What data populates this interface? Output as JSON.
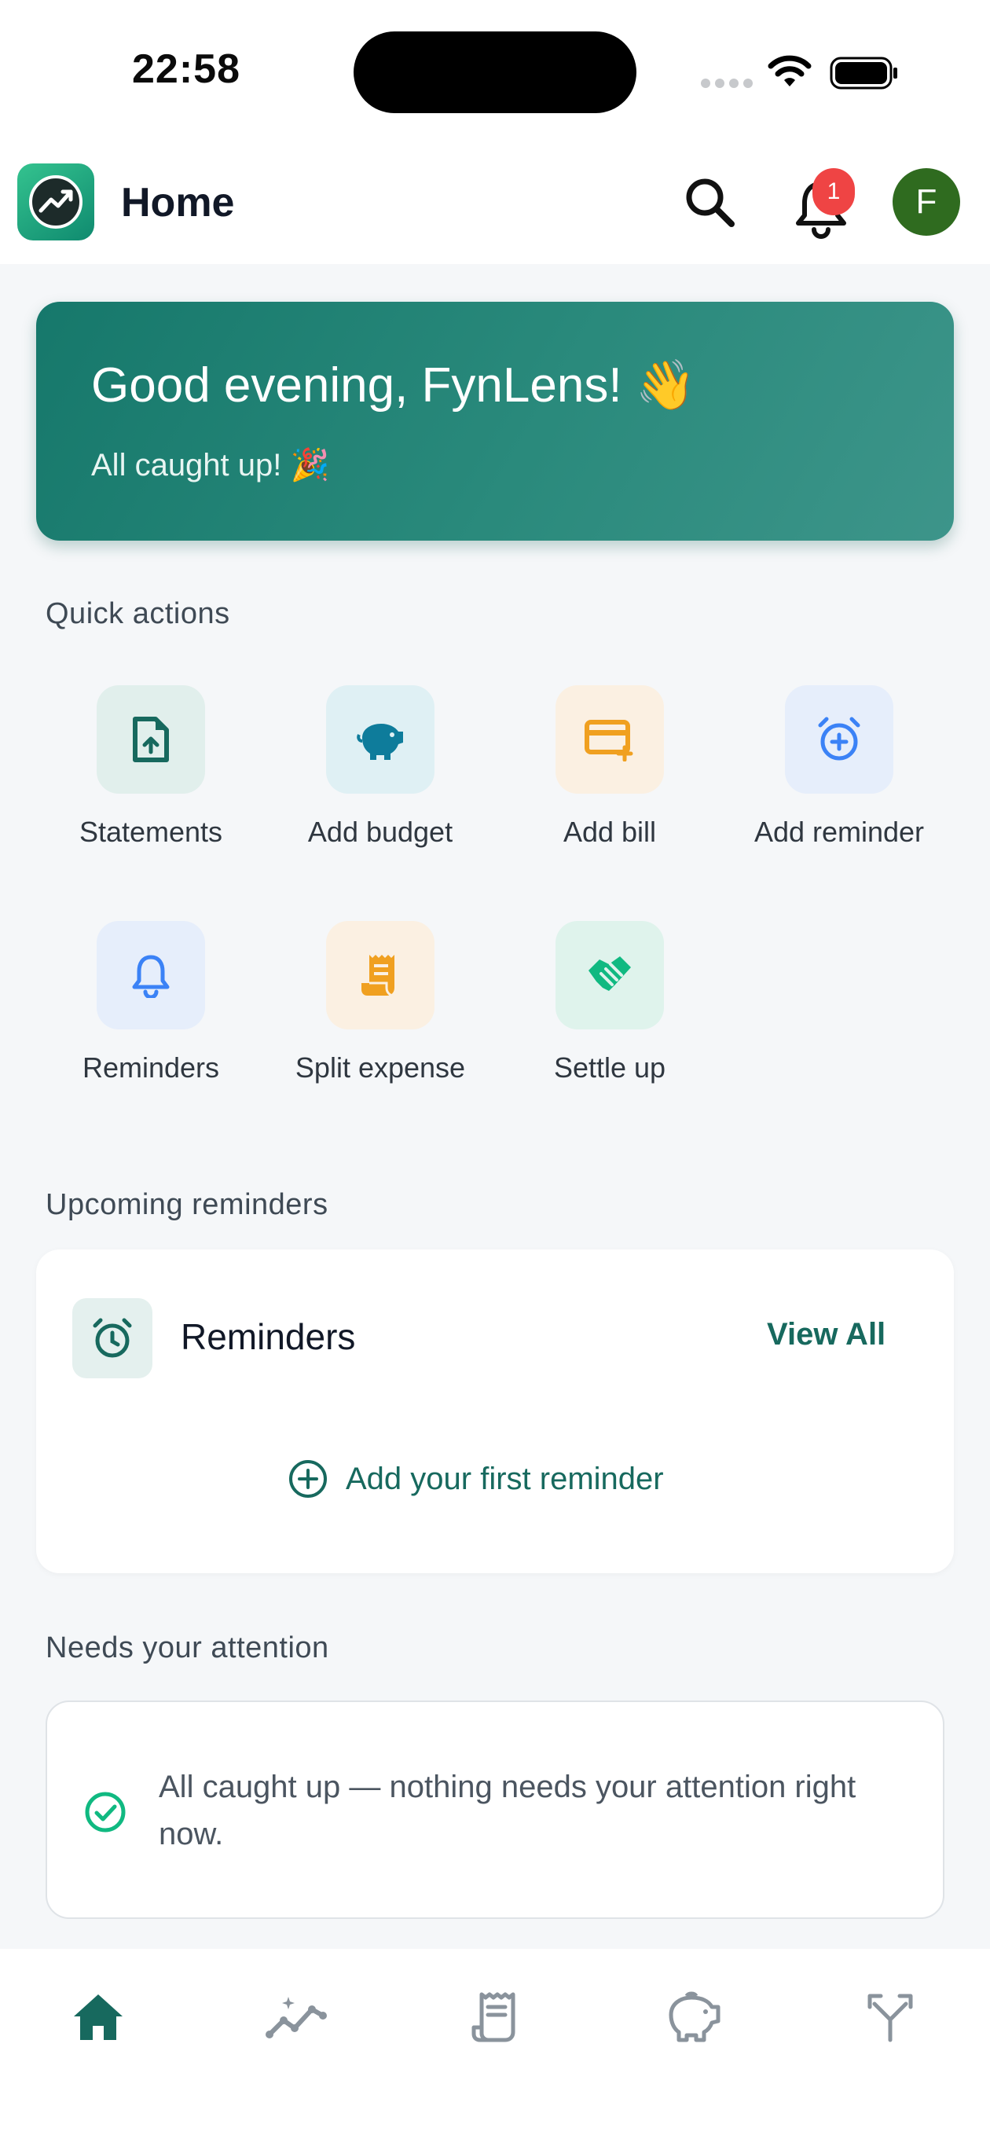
{
  "status_bar": {
    "time": "22:58"
  },
  "header": {
    "title": "Home",
    "notification_count": "1",
    "avatar_initial": "F"
  },
  "greeting": {
    "title": "Good evening, FynLens! 👋",
    "subtitle": "All caught up! 🎉"
  },
  "quick_actions": {
    "label": "Quick actions",
    "items": [
      {
        "label": "Statements",
        "icon": "document-upload-icon",
        "color": "#17695e"
      },
      {
        "label": "Add budget",
        "icon": "piggy-bank-icon",
        "color": "#0e7c9b"
      },
      {
        "label": "Add bill",
        "icon": "credit-card-add-icon",
        "color": "#f0a020"
      },
      {
        "label": "Add reminder",
        "icon": "alarm-add-icon",
        "color": "#3b82f6"
      },
      {
        "label": "Reminders",
        "icon": "bell-icon",
        "color": "#3b82f6"
      },
      {
        "label": "Split expense",
        "icon": "receipt-icon",
        "color": "#f0a020"
      },
      {
        "label": "Settle up",
        "icon": "handshake-icon",
        "color": "#10b981"
      }
    ]
  },
  "upcoming": {
    "label": "Upcoming reminders",
    "card_title": "Reminders",
    "view_all": "View All",
    "add_first": "Add your first reminder"
  },
  "attention": {
    "label": "Needs your attention",
    "message": "All caught up — nothing needs your attention right now."
  },
  "bottom_nav": {
    "items": [
      {
        "icon": "home-icon",
        "active": true
      },
      {
        "icon": "insights-icon",
        "active": false
      },
      {
        "icon": "receipt-icon",
        "active": false
      },
      {
        "icon": "piggy-bank-icon",
        "active": false
      },
      {
        "icon": "split-icon",
        "active": false
      }
    ]
  },
  "colors": {
    "accent": "#17695e",
    "badge": "#ef4444",
    "avatar": "#2f6b1f"
  }
}
